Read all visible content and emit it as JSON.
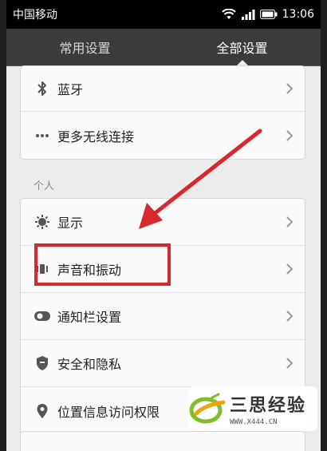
{
  "status_bar": {
    "carrier": "中国移动",
    "time": "13:06"
  },
  "tabs": [
    {
      "label": "常用设置",
      "active": false
    },
    {
      "label": "全部设置",
      "active": true
    }
  ],
  "group_wireless": [
    {
      "label": "蓝牙",
      "icon": "bluetooth-icon"
    },
    {
      "label": "更多无线连接",
      "icon": "more-dots-icon"
    }
  ],
  "section_personal": {
    "title": "个人"
  },
  "group_personal": [
    {
      "label": "显示",
      "icon": "display-icon"
    },
    {
      "label": "声音和振动",
      "icon": "sound-vibration-icon"
    },
    {
      "label": "通知栏设置",
      "icon": "notification-bar-icon"
    },
    {
      "label": "安全和隐私",
      "icon": "shield-icon"
    },
    {
      "label": "位置信息访问权限",
      "icon": "location-pin-icon"
    }
  ],
  "watermark": {
    "title": "三思经验",
    "url": "WWW.X444.CN"
  },
  "colors": {
    "highlight": "#d9272e",
    "tab_bar": "#3b3b3b",
    "background": "#ececec"
  }
}
